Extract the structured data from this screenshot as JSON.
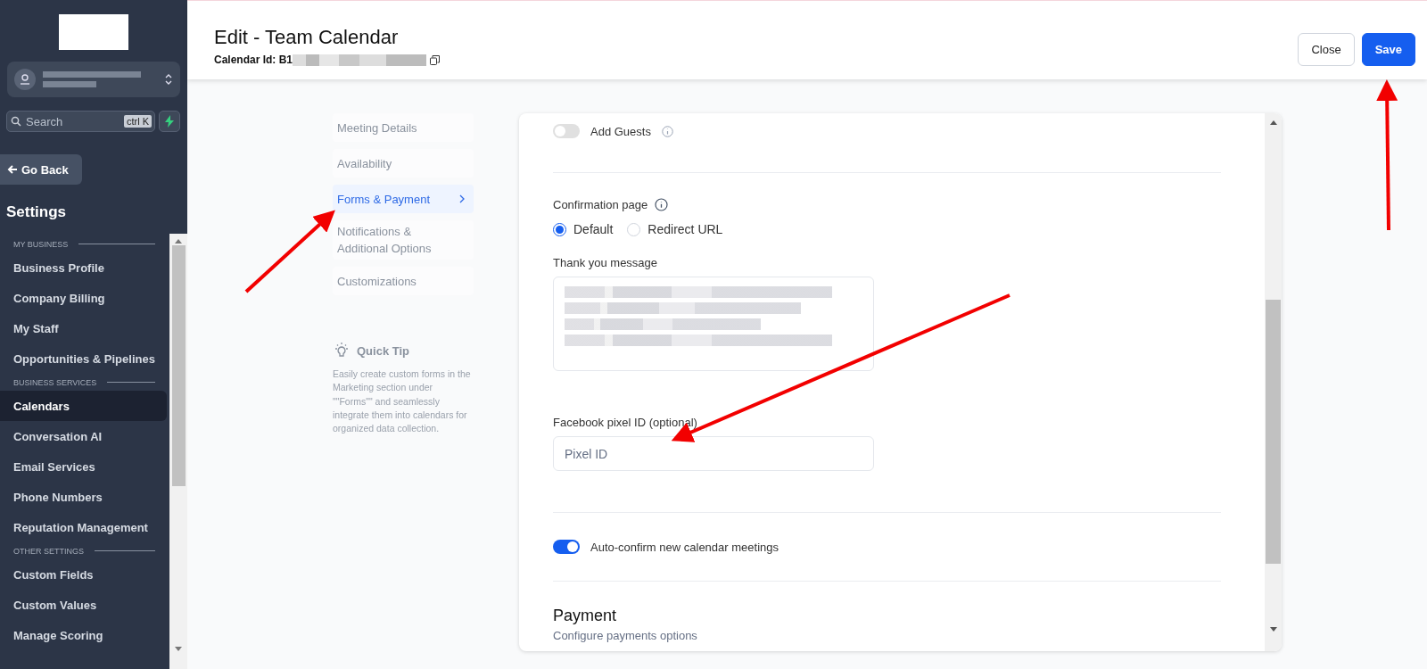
{
  "sidebar": {
    "search": {
      "placeholder": "Search",
      "shortcut": "ctrl K"
    },
    "back": "Go Back",
    "title": "Settings",
    "sections": [
      {
        "heading": "MY BUSINESS",
        "items": [
          {
            "label": "Business Profile",
            "selected": false
          },
          {
            "label": "Company Billing",
            "selected": false
          },
          {
            "label": "My Staff",
            "selected": false
          },
          {
            "label": "Opportunities & Pipelines",
            "selected": false
          }
        ]
      },
      {
        "heading": "BUSINESS SERVICES",
        "items": [
          {
            "label": "Calendars",
            "selected": true
          },
          {
            "label": "Conversation AI",
            "selected": false
          },
          {
            "label": "Email Services",
            "selected": false
          },
          {
            "label": "Phone Numbers",
            "selected": false
          },
          {
            "label": "Reputation Management",
            "selected": false
          }
        ]
      },
      {
        "heading": "OTHER SETTINGS",
        "items": [
          {
            "label": "Custom Fields",
            "selected": false
          },
          {
            "label": "Custom Values",
            "selected": false
          },
          {
            "label": "Manage Scoring",
            "selected": false
          }
        ]
      }
    ]
  },
  "header": {
    "title": "Edit - Team Calendar",
    "id_label": "Calendar Id: B1",
    "buttons": [
      {
        "label": "Close",
        "kind": "secondary"
      },
      {
        "label": "Save",
        "kind": "primary"
      }
    ]
  },
  "nav": {
    "items": [
      {
        "label": "Meeting Details",
        "selected": false
      },
      {
        "label": "Availability",
        "selected": false
      },
      {
        "label": "Forms & Payment",
        "selected": true
      },
      {
        "label": "Notifications & Additional Options",
        "selected": false
      },
      {
        "label": "Customizations",
        "selected": false
      }
    ],
    "tip": {
      "title": "Quick Tip",
      "text": "Easily create custom forms in the Marketing section under \"\"Forms\"\" and seamlessly integrate them into calendars for organized data collection."
    }
  },
  "form": {
    "add_guests": {
      "label": "Add Guests",
      "on": false
    },
    "confirmation": {
      "label": "Confirmation page",
      "options": [
        {
          "label": "Default",
          "selected": true
        },
        {
          "label": "Redirect URL",
          "selected": false
        }
      ]
    },
    "thank_you": {
      "label": "Thank you message"
    },
    "pixel": {
      "label": "Facebook pixel ID (optional)",
      "placeholder": "Pixel ID"
    },
    "auto_confirm": {
      "label": "Auto-confirm new calendar meetings",
      "on": true
    },
    "payment": {
      "title": "Payment",
      "subtitle": "Configure payments options"
    }
  }
}
